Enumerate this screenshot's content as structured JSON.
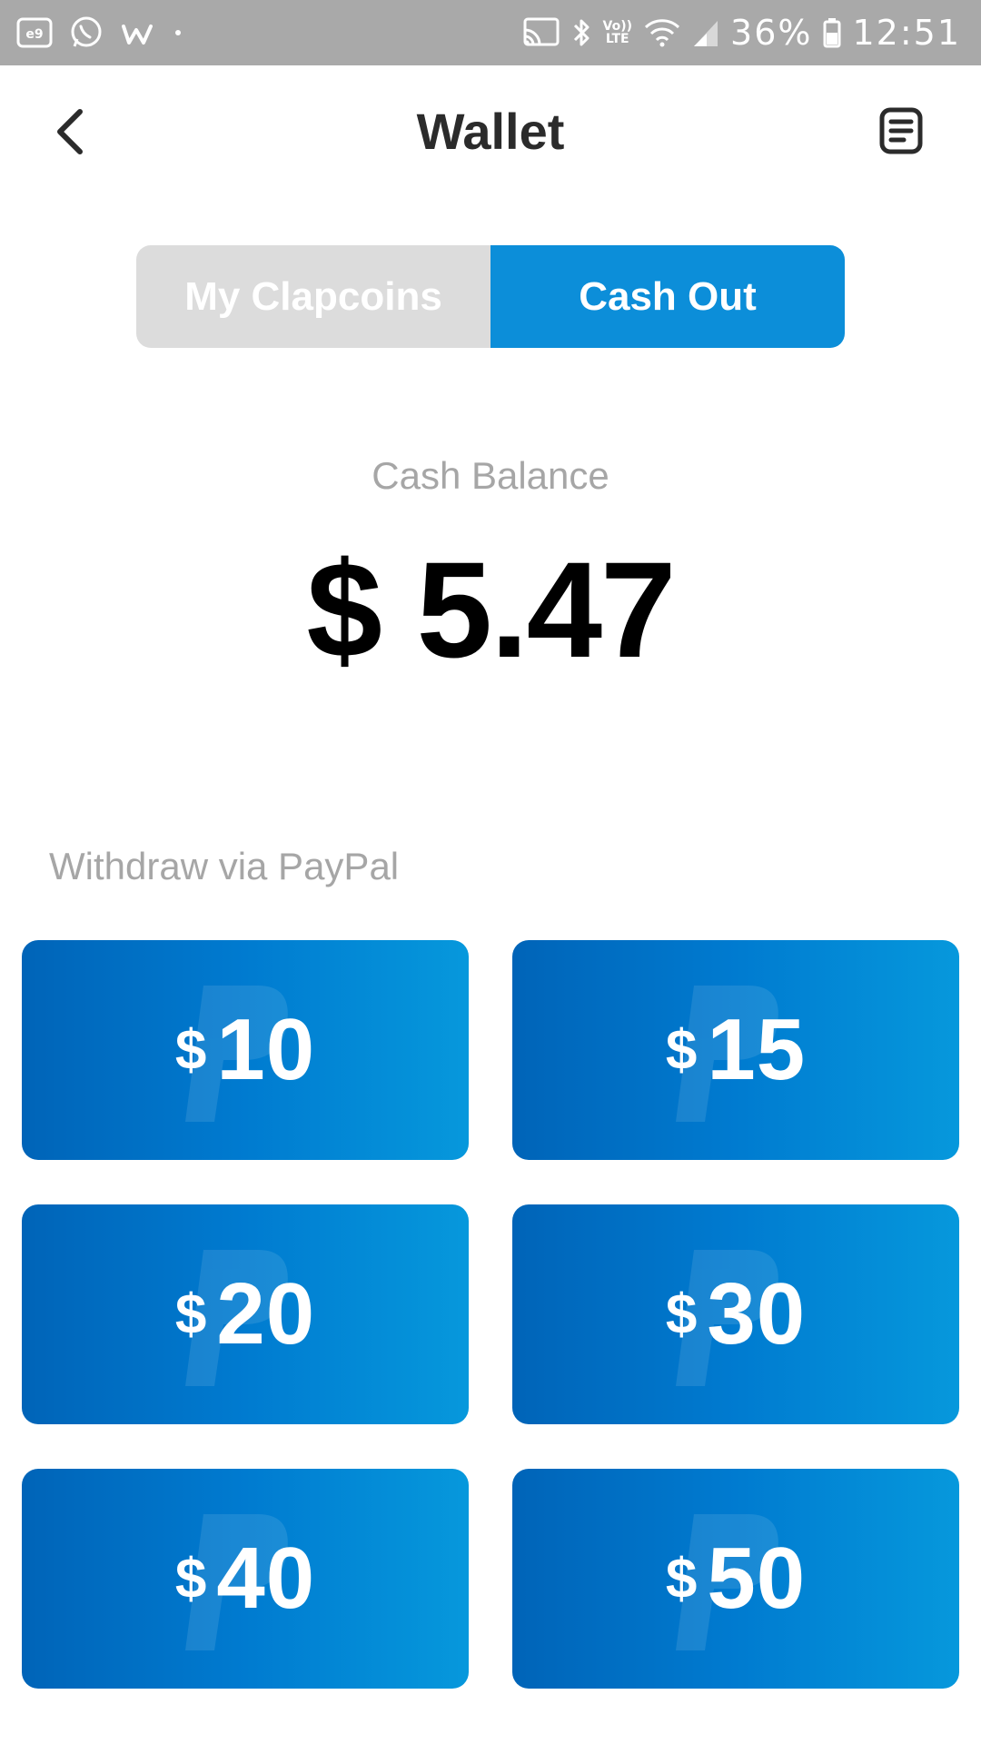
{
  "status_bar": {
    "battery_percent": "36%",
    "time": "12:51",
    "volte_line1": "Vo))",
    "volte_line2": "LTE",
    "icons": [
      "notification-app-icon",
      "whatsapp-icon",
      "w-app-icon",
      "dot-icon",
      "cast-icon",
      "bluetooth-icon",
      "volte-icon",
      "wifi-icon",
      "signal-icon",
      "battery-icon"
    ]
  },
  "header": {
    "title": "Wallet",
    "back_icon": "chevron-left-icon",
    "history_icon": "receipt-icon"
  },
  "tabs": [
    {
      "label": "My Clapcoins",
      "active": false
    },
    {
      "label": "Cash Out",
      "active": true
    }
  ],
  "balance": {
    "label": "Cash Balance",
    "amount": "$ 5.47"
  },
  "withdraw": {
    "label": "Withdraw via PayPal",
    "currency": "$",
    "options": [
      "10",
      "15",
      "20",
      "30",
      "40",
      "50"
    ]
  },
  "colors": {
    "accent": "#0c8ed9",
    "button_gradient_start": "#0064b8",
    "button_gradient_end": "#0698dc",
    "tab_inactive": "#dcdcdc",
    "muted_text": "#a6a6a6",
    "status_bar": "#a9a9a9"
  }
}
